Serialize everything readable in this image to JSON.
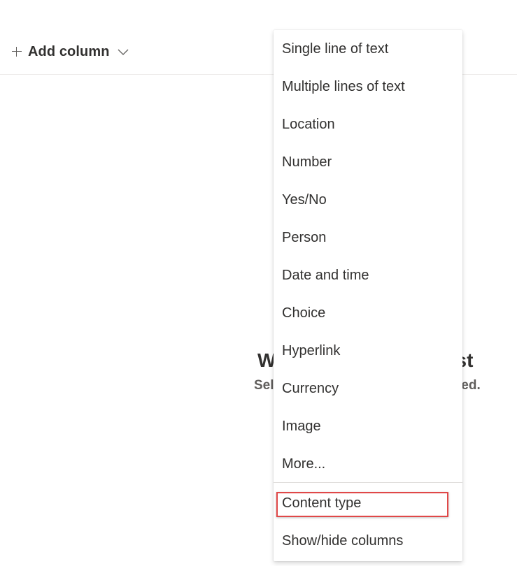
{
  "toolbar": {
    "add_column_label": "Add column"
  },
  "empty_state": {
    "title_left": "W",
    "title_right": "list",
    "subtitle_left": "Sel",
    "subtitle_right": "arted."
  },
  "column_type_menu": {
    "items": [
      {
        "label": "Single line of text"
      },
      {
        "label": "Multiple lines of text"
      },
      {
        "label": "Location"
      },
      {
        "label": "Number"
      },
      {
        "label": "Yes/No"
      },
      {
        "label": "Person"
      },
      {
        "label": "Date and time"
      },
      {
        "label": "Choice"
      },
      {
        "label": "Hyperlink"
      },
      {
        "label": "Currency"
      },
      {
        "label": "Image"
      },
      {
        "label": "More..."
      }
    ],
    "content_type_label": "Content type",
    "show_hide_label": "Show/hide columns"
  },
  "colors": {
    "highlight_border": "#e04848",
    "text_primary": "#323130",
    "text_secondary": "#605e5c"
  }
}
